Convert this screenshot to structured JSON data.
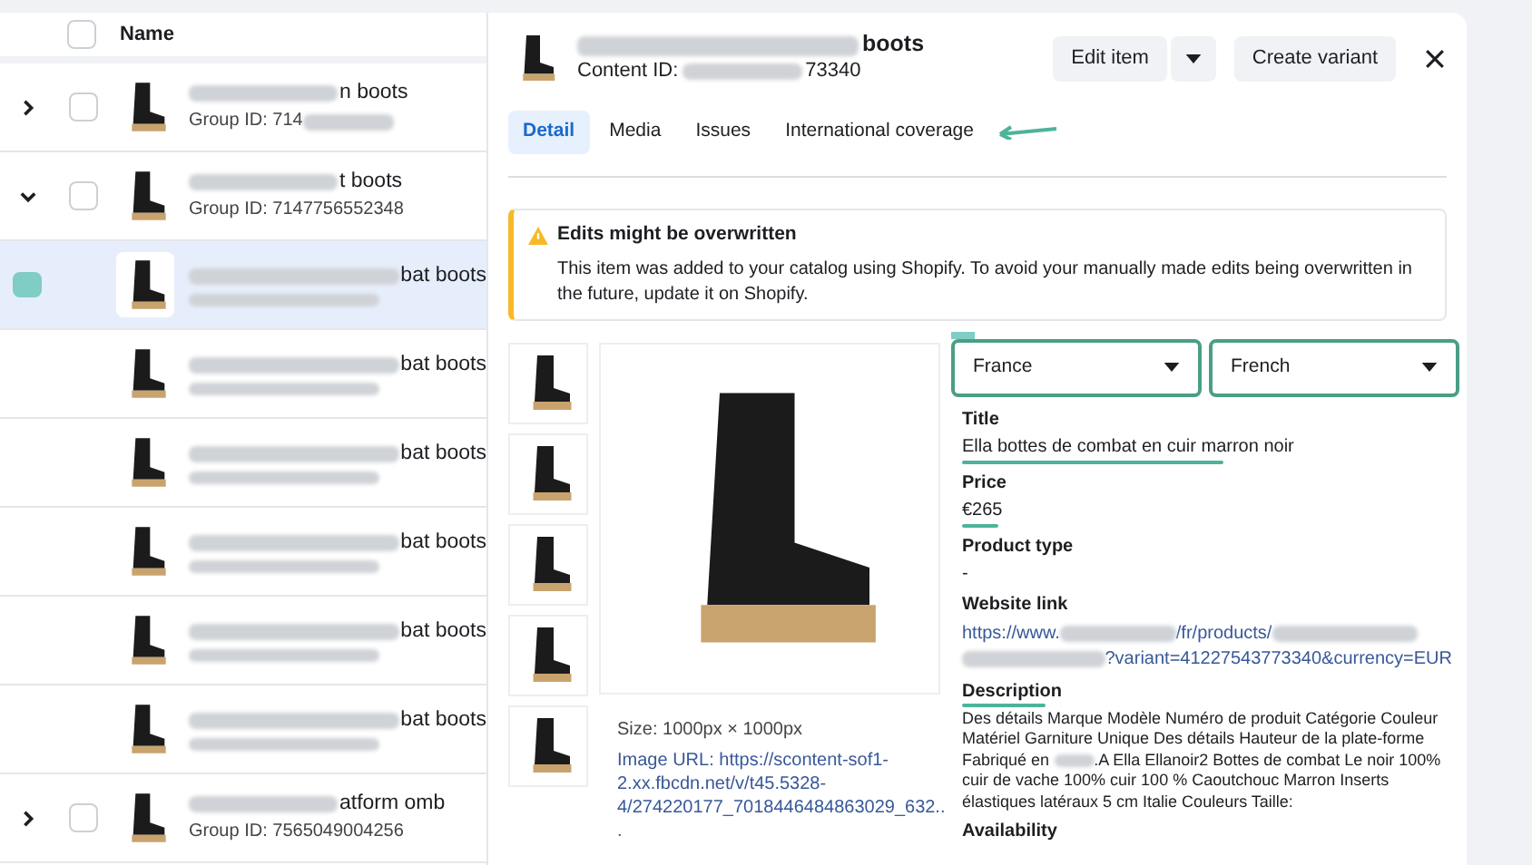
{
  "list": {
    "header": {
      "label": "Name",
      "checked": false
    },
    "rows": [
      {
        "kind": "group",
        "expanded": false,
        "checked": false,
        "selected": false,
        "name": "n boots",
        "sub": "Group ID: 714"
      },
      {
        "kind": "group",
        "expanded": true,
        "checked": false,
        "selected": false,
        "name": "t boots",
        "sub": "Group ID: 7147756552348"
      },
      {
        "kind": "variant",
        "selected": true,
        "name": "bat boots"
      },
      {
        "kind": "variant",
        "selected": false,
        "name": "bat boots"
      },
      {
        "kind": "variant",
        "selected": false,
        "name": "bat boots"
      },
      {
        "kind": "variant",
        "selected": false,
        "name": "bat boots"
      },
      {
        "kind": "variant",
        "selected": false,
        "name": "bat boots"
      },
      {
        "kind": "variant",
        "selected": false,
        "name": "bat boots"
      },
      {
        "kind": "group",
        "expanded": false,
        "checked": false,
        "selected": false,
        "name": "atform omb",
        "sub": "Group ID: 7565049004256"
      }
    ]
  },
  "detail": {
    "title": "boots",
    "content_id_label": "Content ID:",
    "content_id": "73340",
    "buttons": [
      {
        "kind": "text",
        "label": "Edit item"
      },
      {
        "kind": "caret"
      },
      {
        "kind": "text",
        "label": "Create variant"
      },
      {
        "kind": "close"
      }
    ],
    "tabs": [
      {
        "label": "Detail",
        "selected": true,
        "pointed": false
      },
      {
        "label": "Media",
        "selected": false,
        "pointed": false
      },
      {
        "label": "Issues",
        "selected": false,
        "pointed": false
      },
      {
        "label": "International coverage",
        "selected": false,
        "pointed": true
      }
    ],
    "alert": {
      "title": "Edits might be overwritten",
      "text": "This item was added to your catalog using Shopify. To avoid your manually made edits being overwritten in the future, update it on Shopify."
    },
    "media": {
      "size": "Size: 1000px × 1000px",
      "image_url": "Image URL: https://scontent-sof1-2.xx.fbcdn.net/v/t45.5328-4/274220177_7018446484863029_632..."
    },
    "selects": [
      {
        "value": "France",
        "highlighted": true
      },
      {
        "value": "French",
        "highlighted": true
      }
    ],
    "fields": [
      {
        "kind": "text",
        "label": "Title",
        "value": "Ella bottes de combat en cuir marron noir",
        "underlined": true
      },
      {
        "kind": "text",
        "label": "Price",
        "value": "€265",
        "underlined": true
      },
      {
        "kind": "text",
        "label": "Product type",
        "value": "-"
      },
      {
        "kind": "link",
        "label": "Website link",
        "parts": [
          "https://www.",
          "/fr/products/",
          "?variant=41227543773340&currency=EUR"
        ]
      },
      {
        "kind": "paragraph",
        "label": "Description",
        "parts": [
          "Des détails Marque Modèle Numéro de produit Catégorie Couleur Matériel Garniture Unique Des détails Hauteur de la plate-forme Fabriqué en",
          ".A Ella Ellanoir2 Bottes de combat Le noir 100% cuir de vache 100% cuir 100 % Caoutchouc Marron Inserts élastiques latéraux 5 cm Italie Couleurs Taille:"
        ],
        "label_underlined": true
      },
      {
        "kind": "label",
        "label": "Availability"
      }
    ]
  }
}
